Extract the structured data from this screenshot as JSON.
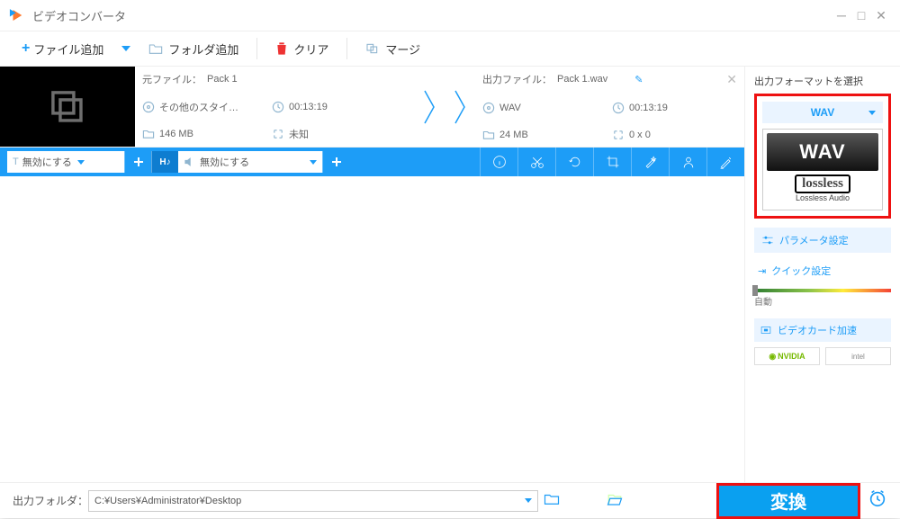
{
  "window": {
    "title": "ビデオコンバータ"
  },
  "toolbar": {
    "addFile": "ファイル追加",
    "addFolder": "フォルダ追加",
    "clear": "クリア",
    "merge": "マージ"
  },
  "item": {
    "srcLabel": "元ファイル：",
    "srcName": "Pack 1",
    "dstLabel": "出力ファイル：",
    "dstName": "Pack 1.wav",
    "srcStyle": "その他のスタイ…",
    "srcDuration": "00:13:19",
    "srcSize": "146 MB",
    "srcRes": "未知",
    "dstFormat": "WAV",
    "dstDuration": "00:13:19",
    "dstSize": "24 MB",
    "dstRes": "0 x 0"
  },
  "bluebar": {
    "subtitle": "無効にする",
    "audio": "無効にする"
  },
  "rightPanel": {
    "heading": "出力フォーマットを選択",
    "format": "WAV",
    "formatBig": "WAV",
    "lossless": "lossless",
    "losslessSub": "Lossless Audio",
    "paramBtn": "パラメータ設定",
    "quickBtn": "クイック設定",
    "sliderLabel": "自動",
    "gpu": "ビデオカード加速",
    "nvidia": "NVIDIA",
    "intel": "intel"
  },
  "footer": {
    "label": "出力フォルダ：",
    "path": "C:¥Users¥Administrator¥Desktop",
    "convert": "変換"
  }
}
